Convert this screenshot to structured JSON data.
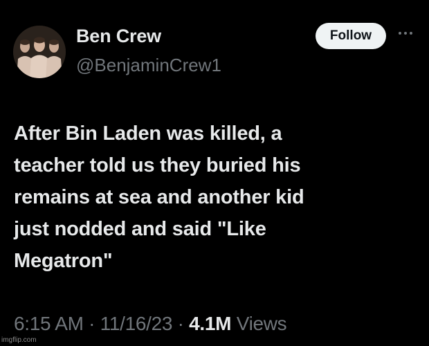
{
  "author": {
    "display_name": "Ben Crew",
    "handle": "@BenjaminCrew1",
    "avatar": "profile-photo"
  },
  "actions": {
    "follow_label": "Follow",
    "more_icon": "more-horizontal-icon"
  },
  "tweet": {
    "lines": [
      "After Bin Laden was killed, a",
      "teacher told us they buried his",
      "remains at sea and another kid",
      "just nodded and said \"Like",
      "Megatron\""
    ]
  },
  "meta": {
    "time": "6:15 AM",
    "separator": "·",
    "date": "11/16/23",
    "views_count": "4.1M",
    "views_label": "Views"
  },
  "watermark": "imgflip.com",
  "colors": {
    "background": "#000000",
    "primary_text": "#e7e9ea",
    "secondary_text": "#71767b",
    "follow_button_bg": "#eff3f4",
    "follow_button_text": "#0f1419"
  }
}
